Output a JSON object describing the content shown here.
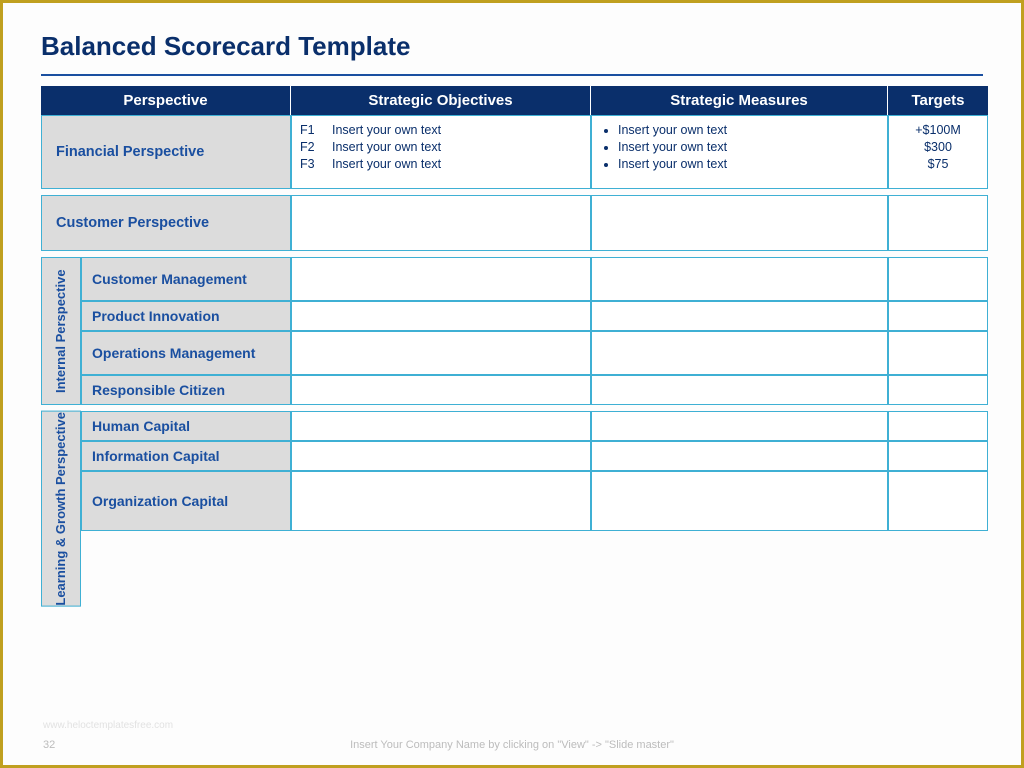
{
  "title": "Balanced Scorecard Template",
  "headers": {
    "perspective": "Perspective",
    "objectives": "Strategic Objectives",
    "measures": "Strategic Measures",
    "targets": "Targets"
  },
  "financial": {
    "label": "Financial Perspective",
    "objectives": {
      "f1_code": "F1",
      "f1_text": "Insert your own text",
      "f2_code": "F2",
      "f2_text": "Insert your own text",
      "f3_code": "F3",
      "f3_text": "Insert your own text"
    },
    "measures": {
      "m1": "Insert your own text",
      "m2": "Insert your own text",
      "m3": "Insert your own text"
    },
    "targets": {
      "t1": "+$100M",
      "t2": "$300",
      "t3": "$75"
    }
  },
  "customer": {
    "label": "Customer Perspective"
  },
  "internal": {
    "vlabel": "Internal Perspective",
    "rows": {
      "r1": "Customer Management",
      "r2": "Product Innovation",
      "r3": "Operations Management",
      "r4": "Responsible Citizen"
    }
  },
  "learning": {
    "vlabel": "Learning & Growth Perspective",
    "rows": {
      "r1": "Human Capital",
      "r2": "Information Capital",
      "r3": "Organization Capital"
    }
  },
  "footer": {
    "watermark": "www.heloctemplatesfree.com",
    "page": "32",
    "note": "Insert Your Company Name by clicking on \"View\" -> \"Slide master\""
  }
}
